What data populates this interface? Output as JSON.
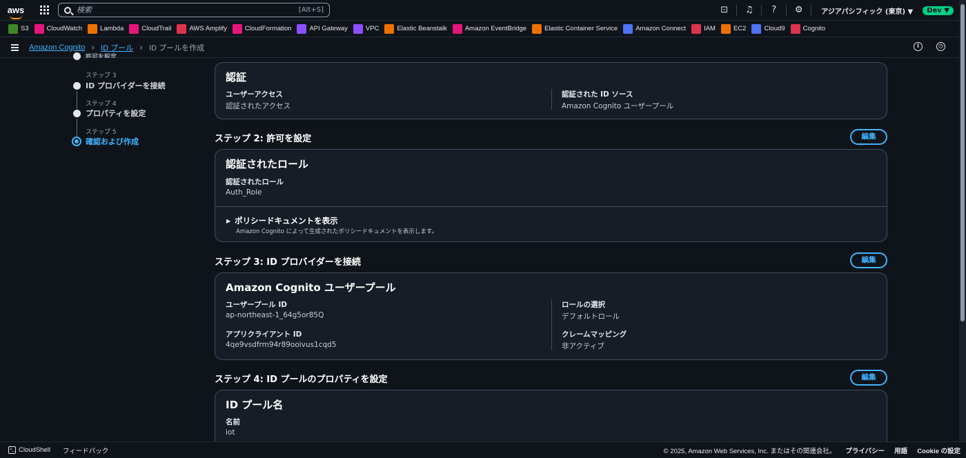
{
  "topnav": {
    "logo": "aws",
    "search_placeholder": "検索",
    "search_shortcut": "[Alt+S]",
    "region": "アジアパシフィック (東京) ▼",
    "account_badge": "Dev ▼"
  },
  "favorites": [
    {
      "label": "S3",
      "color": "#3f8624"
    },
    {
      "label": "CloudWatch",
      "color": "#e7157b"
    },
    {
      "label": "Lambda",
      "color": "#ed7100"
    },
    {
      "label": "CloudTrail",
      "color": "#e7157b"
    },
    {
      "label": "AWS Amplify",
      "color": "#dd344c"
    },
    {
      "label": "CloudFormation",
      "color": "#e7157b"
    },
    {
      "label": "API Gateway",
      "color": "#8c4fff"
    },
    {
      "label": "VPC",
      "color": "#8c4fff"
    },
    {
      "label": "Elastic Beanstalk",
      "color": "#ed7100"
    },
    {
      "label": "Amazon EventBridge",
      "color": "#e7157b"
    },
    {
      "label": "Elastic Container Service",
      "color": "#ed7100"
    },
    {
      "label": "Amazon Connect",
      "color": "#4d72f3"
    },
    {
      "label": "IAM",
      "color": "#dd344c"
    },
    {
      "label": "EC2",
      "color": "#ed7100"
    },
    {
      "label": "Cloud9",
      "color": "#4d72f3"
    },
    {
      "label": "Cognito",
      "color": "#dd344c"
    }
  ],
  "breadcrumb": {
    "items": [
      "Amazon Cognito",
      "ID プール",
      "ID プールを作成"
    ]
  },
  "steps": {
    "partial_top": "許可を設定",
    "items": [
      {
        "label": "ステップ 3",
        "title": "ID プロバイダーを接続"
      },
      {
        "label": "ステップ 4",
        "title": "プロパティを設定"
      },
      {
        "label": "ステップ 5",
        "title": "確認および作成"
      }
    ]
  },
  "auth_card": {
    "title": "認証",
    "user_access_key": "ユーザーアクセス",
    "user_access_value": "認証されたアクセス",
    "id_source_key": "認証された ID ソース",
    "id_source_value": "Amazon Cognito ユーザープール"
  },
  "step2": {
    "title": "ステップ 2: 許可を設定",
    "edit": "編集",
    "card_title": "認証されたロール",
    "role_key": "認証されたロール",
    "role_value": "Auth_Role",
    "policy_title": "ポリシードキュメントを表示",
    "policy_desc": "Amazon Cognito によって生成されたポリシードキュメントを表示します。"
  },
  "step3": {
    "title": "ステップ 3: ID プロバイダーを接続",
    "edit": "編集",
    "card_title": "Amazon Cognito ユーザープール",
    "pool_id_key": "ユーザープール ID",
    "pool_id_value": "ap-northeast-1_64g5or85Q",
    "role_select_key": "ロールの選択",
    "role_select_value": "デフォルトロール",
    "client_id_key": "アプリクライアント ID",
    "client_id_value": "4qe9vsdfrm94r89ooivus1cqd5",
    "claim_key": "クレームマッピング",
    "claim_value": "非アクティブ"
  },
  "step4": {
    "title": "ステップ 4: ID プールのプロパティを設定",
    "edit": "編集",
    "card_title": "ID プール名",
    "name_key": "名前",
    "name_value": "iot"
  },
  "footer": {
    "cloudshell": "CloudShell",
    "feedback": "フィードバック",
    "copyright": "© 2025, Amazon Web Services, Inc. またはその関連会社。",
    "privacy": "プライバシー",
    "terms": "用語",
    "cookie": "Cookie の設定"
  }
}
